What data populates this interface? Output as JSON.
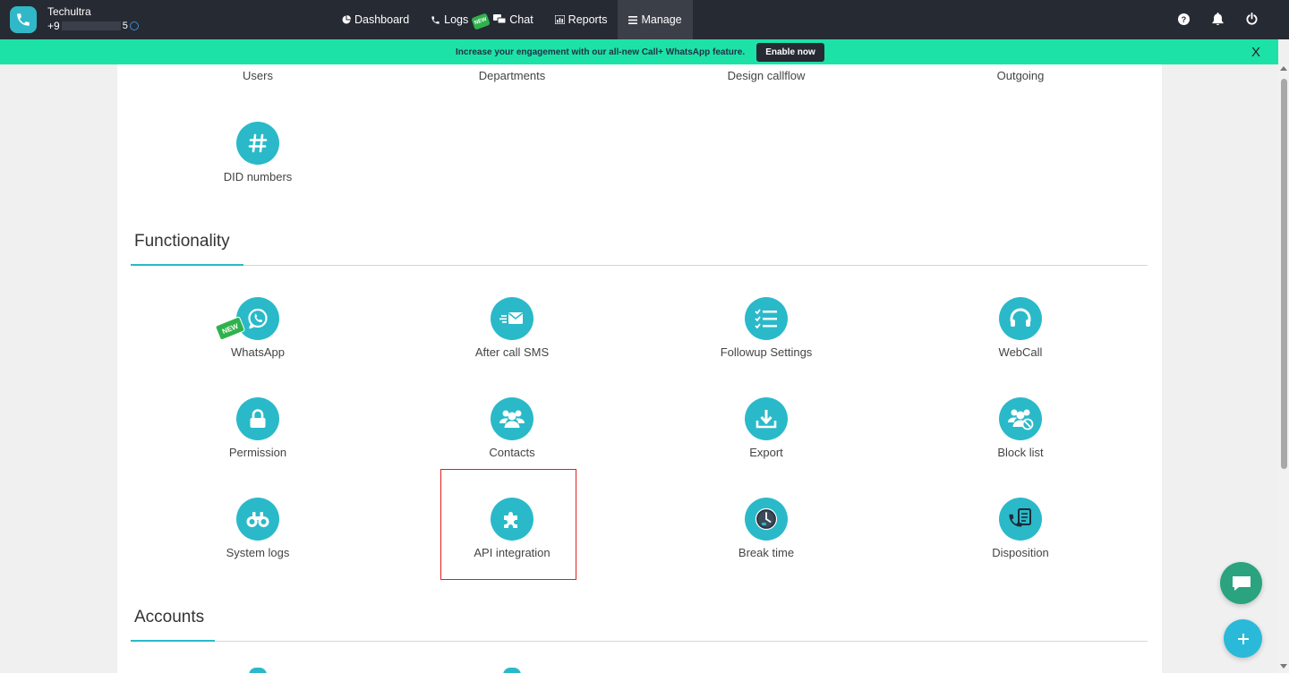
{
  "brand": {
    "name": "Techultra",
    "number_prefix": "+9",
    "number_suffix": "5"
  },
  "nav": {
    "dashboard": "Dashboard",
    "logs": "Logs",
    "chat": "Chat",
    "chat_badge": "NEW",
    "reports": "Reports",
    "manage": "Manage"
  },
  "banner": {
    "text": "Increase your engagement with our all-new Call+ WhatsApp feature.",
    "button": "Enable now",
    "close": "X"
  },
  "top_row": [
    "Users",
    "Departments",
    "Design callflow",
    "Outgoing"
  ],
  "setup_items": [
    {
      "label": "DID numbers",
      "icon": "hash-icon"
    }
  ],
  "functionality": {
    "title": "Functionality",
    "items": [
      {
        "label": "WhatsApp",
        "icon": "whatsapp-icon",
        "badge": "NEW"
      },
      {
        "label": "After call SMS",
        "icon": "envelope-fast-icon"
      },
      {
        "label": "Followup Settings",
        "icon": "checklist-icon"
      },
      {
        "label": "WebCall",
        "icon": "headset-icon"
      },
      {
        "label": "Permission",
        "icon": "lock-icon"
      },
      {
        "label": "Contacts",
        "icon": "users-group-icon"
      },
      {
        "label": "Export",
        "icon": "download-icon"
      },
      {
        "label": "Block list",
        "icon": "users-blocked-icon"
      },
      {
        "label": "System logs",
        "icon": "binoculars-icon"
      },
      {
        "label": "API integration",
        "icon": "puzzle-icon"
      },
      {
        "label": "Break time",
        "icon": "clock-break-icon"
      },
      {
        "label": "Disposition",
        "icon": "phone-note-icon"
      }
    ]
  },
  "accounts": {
    "title": "Accounts"
  },
  "colors": {
    "accent": "#2ab9c9",
    "nav_bg": "#262a33",
    "banner_bg": "#1de2a8",
    "highlight": "#e0201c",
    "badge_green": "#2fb24c"
  }
}
